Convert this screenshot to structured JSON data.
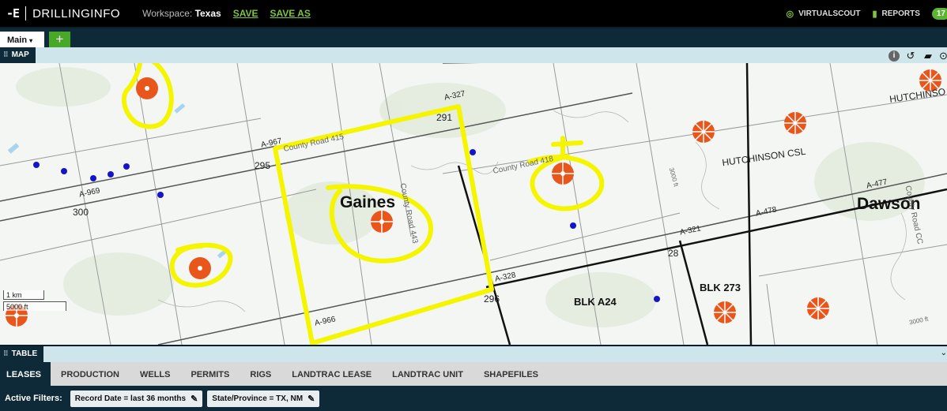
{
  "topbar": {
    "logo_mark": "-E",
    "logo_text": "DRILLINGINFO",
    "workspace_label": "Workspace:",
    "workspace_name": "Texas",
    "save": "SAVE",
    "save_as": "SAVE AS",
    "virtualscout": "VIRTUALSCOUT",
    "reports": "REPORTS",
    "reports_badge": "17"
  },
  "tabs": {
    "main": "Main",
    "add": "+"
  },
  "map_panel": {
    "title": "MAP",
    "tools": [
      "info-icon",
      "reset-icon",
      "map-layers-icon",
      "settings-icon"
    ]
  },
  "map": {
    "counties": [
      "Gaines",
      "Dawson"
    ],
    "blocks": [
      "BLK A24",
      "BLK 273"
    ],
    "surveys": [
      "HUTCHINSON CSL",
      "HUTCHINSO"
    ],
    "roads": [
      "County Road 415",
      "County Road 418",
      "County Road 443",
      "County Road CC"
    ],
    "abstracts": [
      "A-327",
      "291",
      "A-967",
      "295",
      "A-969",
      "300",
      "A-477",
      "A-478",
      "A-321",
      "28",
      "A-328",
      "296",
      "A-966"
    ],
    "contours": [
      "3000 ft",
      "3000 ft"
    ],
    "scale_km": "1 km",
    "scale_ft": "5000 ft",
    "colors": {
      "well_marker": "#e8561c",
      "point_marker": "#1515c8",
      "annotation": "#f5f500"
    }
  },
  "table_panel": {
    "title": "TABLE",
    "tabs": [
      "LEASES",
      "PRODUCTION",
      "WELLS",
      "PERMITS",
      "RIGS",
      "LANDTRAC LEASE",
      "LANDTRAC UNIT",
      "SHAPEFILES"
    ],
    "active_tab": "LEASES"
  },
  "filters": {
    "label": "Active Filters:",
    "items": [
      "Record Date = last 36 months",
      "State/Province = TX, NM"
    ]
  }
}
